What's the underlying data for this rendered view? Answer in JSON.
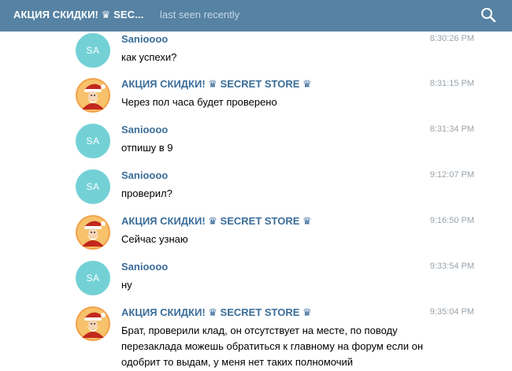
{
  "header": {
    "title": "АКЦИЯ СКИДКИ! ♛ SEC...",
    "status": "last seen recently",
    "search_icon": "search-icon"
  },
  "colors": {
    "header_bg": "#5682a3",
    "author": "#3a6d99",
    "avatar_initials_bg": "#73d1d6",
    "time": "#9aa3ab"
  },
  "messages": [
    {
      "author": "Sanioooo",
      "avatar": "SA",
      "time": "8:30:26 PM",
      "text": "как успехи?"
    },
    {
      "author": "АКЦИЯ СКИДКИ! ♛ SECRET STORE ♛",
      "avatar": "santa-avatar",
      "time": "8:31:15 PM",
      "text": "Через пол часа будет проверено"
    },
    {
      "author": "Sanioooo",
      "avatar": "SA",
      "time": "8:31:34 PM",
      "text": "отпишу в 9"
    },
    {
      "author": "Sanioooo",
      "avatar": "SA",
      "time": "9:12:07 PM",
      "text": "проверил?"
    },
    {
      "author": "АКЦИЯ СКИДКИ! ♛ SECRET STORE ♛",
      "avatar": "santa-avatar",
      "time": "9:16:50 PM",
      "text": "Сейчас узнаю"
    },
    {
      "author": "Sanioooo",
      "avatar": "SA",
      "time": "9:33:54 PM",
      "text": "ну"
    },
    {
      "author": "АКЦИЯ СКИДКИ! ♛ SECRET STORE ♛",
      "avatar": "santa-avatar",
      "time": "9:35:04 PM",
      "text": "Брат, проверили клад, он отсутствует на месте, по поводу перезаклада можешь обратиться к главному на форум если он одобрит то выдам, у меня нет таких полномочий"
    }
  ]
}
